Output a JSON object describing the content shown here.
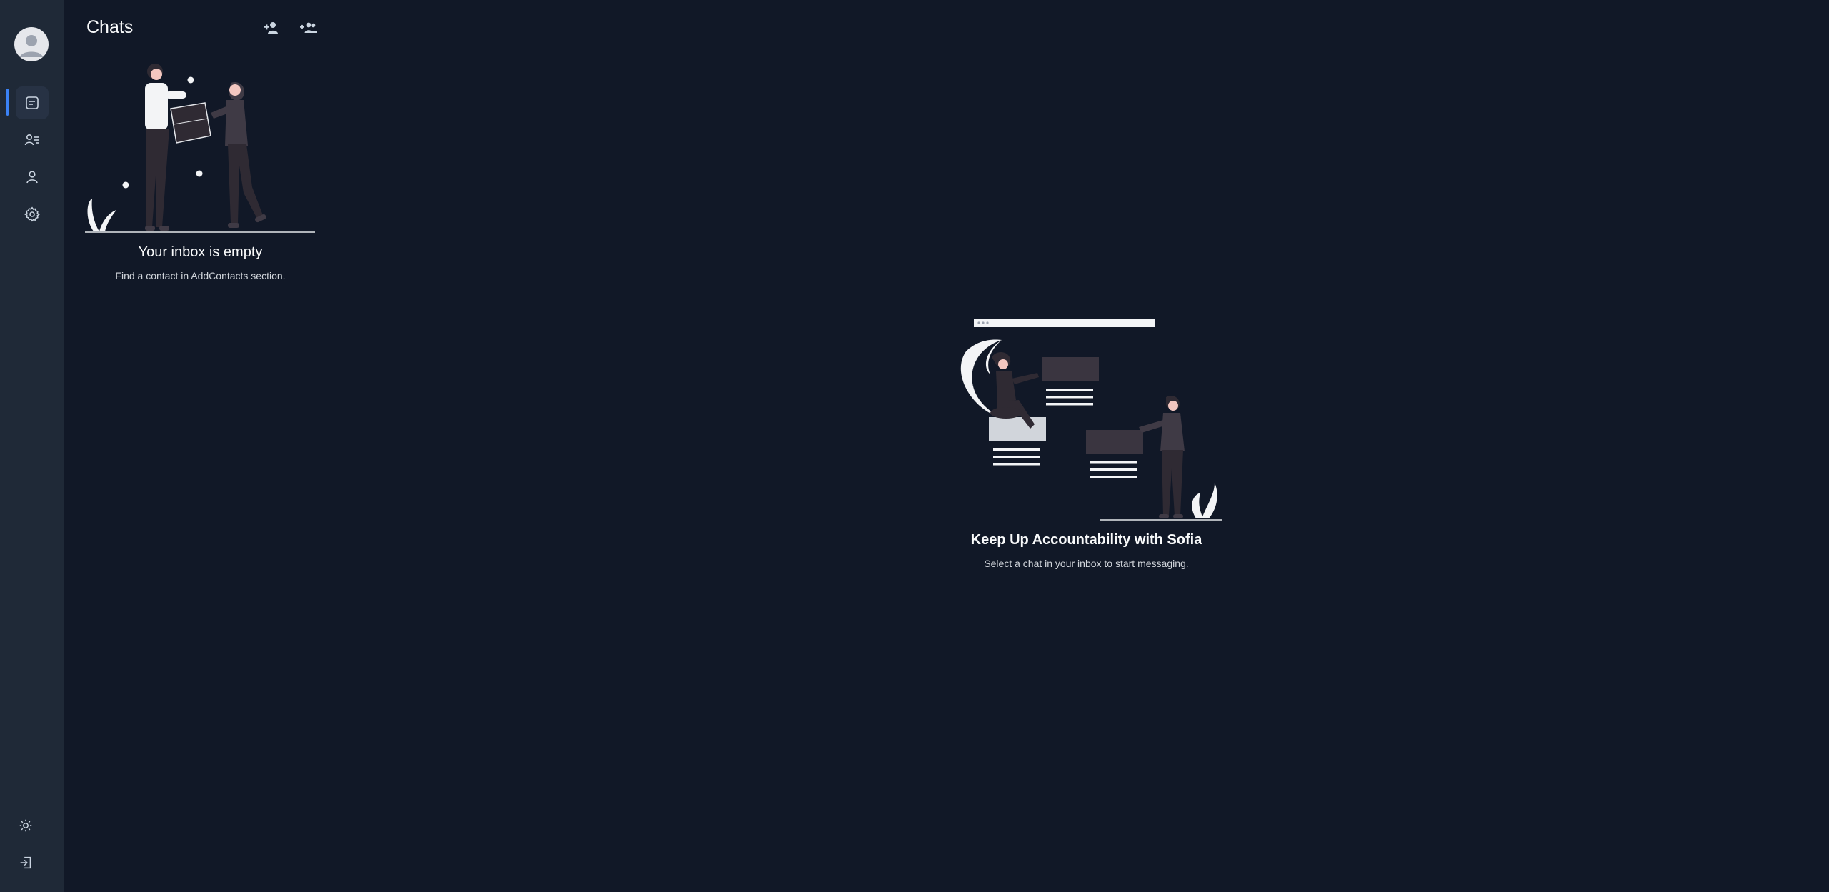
{
  "sidebar": {
    "avatar_icon": "user-avatar",
    "nav": [
      {
        "name": "chats",
        "icon": "chat-icon",
        "active": true
      },
      {
        "name": "contacts",
        "icon": "contacts-list-icon",
        "active": false
      },
      {
        "name": "profile",
        "icon": "user-icon",
        "active": false
      },
      {
        "name": "settings",
        "icon": "gear-icon",
        "active": false
      }
    ],
    "bottom": [
      {
        "name": "theme-toggle",
        "icon": "sun-icon"
      },
      {
        "name": "logout",
        "icon": "logout-icon"
      }
    ],
    "accent": "#3b82f6"
  },
  "chats_panel": {
    "title": "Chats",
    "actions": [
      {
        "name": "add-contact",
        "icon": "add-user-icon"
      },
      {
        "name": "add-group",
        "icon": "add-group-icon"
      }
    ],
    "empty_title": "Your inbox is empty",
    "empty_subtitle": "Find a contact in AddContacts section."
  },
  "main": {
    "title": "Keep Up Accountability with Sofia",
    "subtitle": "Select a chat in your inbox to start messaging."
  },
  "colors": {
    "background": "#111827",
    "rail": "#1f2937",
    "text_primary": "#f9fafb",
    "text_secondary": "#d1d5db"
  }
}
